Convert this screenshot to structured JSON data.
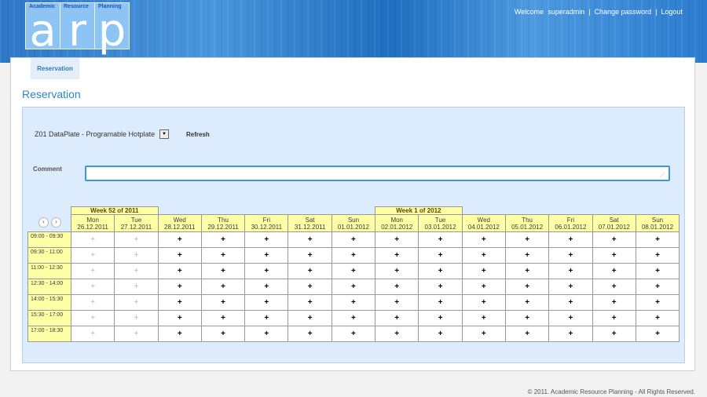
{
  "logo": {
    "words": [
      "Academic",
      "Resource",
      "Planning"
    ],
    "letters": [
      "a",
      "r",
      "p"
    ]
  },
  "topnav": {
    "welcome": "Welcome",
    "user": "superadmin",
    "change_password": "Change password",
    "logout": "Logout",
    "separator": "|"
  },
  "tab": {
    "label": "Reservation"
  },
  "page_title": "Reservation",
  "resource_select": {
    "value": "Z01 DataPlate - Programable Hotplate"
  },
  "refresh_label": "Refresh",
  "comment": {
    "label": "Comment",
    "value": ""
  },
  "nav": {
    "prev": "‹",
    "next": "›"
  },
  "weeks": [
    {
      "label": "Week 52 of 2011"
    },
    {
      "label": "Week 1 of 2012"
    }
  ],
  "days": [
    {
      "name": "Mon",
      "date": "26.12.2011",
      "past": true
    },
    {
      "name": "Tue",
      "date": "27.12.2011",
      "past": true
    },
    {
      "name": "Wed",
      "date": "28.12.2011",
      "past": false
    },
    {
      "name": "Thu",
      "date": "29.12.2011",
      "past": false
    },
    {
      "name": "Fri",
      "date": "30.12.2011",
      "past": false
    },
    {
      "name": "Sat",
      "date": "31.12.2011",
      "past": false
    },
    {
      "name": "Sun",
      "date": "01.01.2012",
      "past": false
    },
    {
      "name": "Mon",
      "date": "02.01.2012",
      "past": false
    },
    {
      "name": "Tue",
      "date": "03.01.2012",
      "past": false
    },
    {
      "name": "Wed",
      "date": "04.01.2012",
      "past": false
    },
    {
      "name": "Thu",
      "date": "05.01.2012",
      "past": false
    },
    {
      "name": "Fri",
      "date": "06.01.2012",
      "past": false
    },
    {
      "name": "Sat",
      "date": "07.01.2012",
      "past": false
    },
    {
      "name": "Sun",
      "date": "08.01.2012",
      "past": false
    }
  ],
  "slots": [
    "09:00 - 09:30",
    "09:30 - 11:00",
    "11:00 - 12:30",
    "12:30 - 14:00",
    "14:00 - 15:30",
    "15:30 - 17:00",
    "17:00 - 18:30"
  ],
  "cell_symbol": "+",
  "footer": "© 2011. Academic Resource Planning - All Rights Reserved.",
  "colors": {
    "header_blue": "#2e78c8",
    "panel_bg": "#ddecfd",
    "grid_yellow": "#ffffa6",
    "title_blue": "#2f86c9",
    "comment_border": "#3a9ad9"
  }
}
